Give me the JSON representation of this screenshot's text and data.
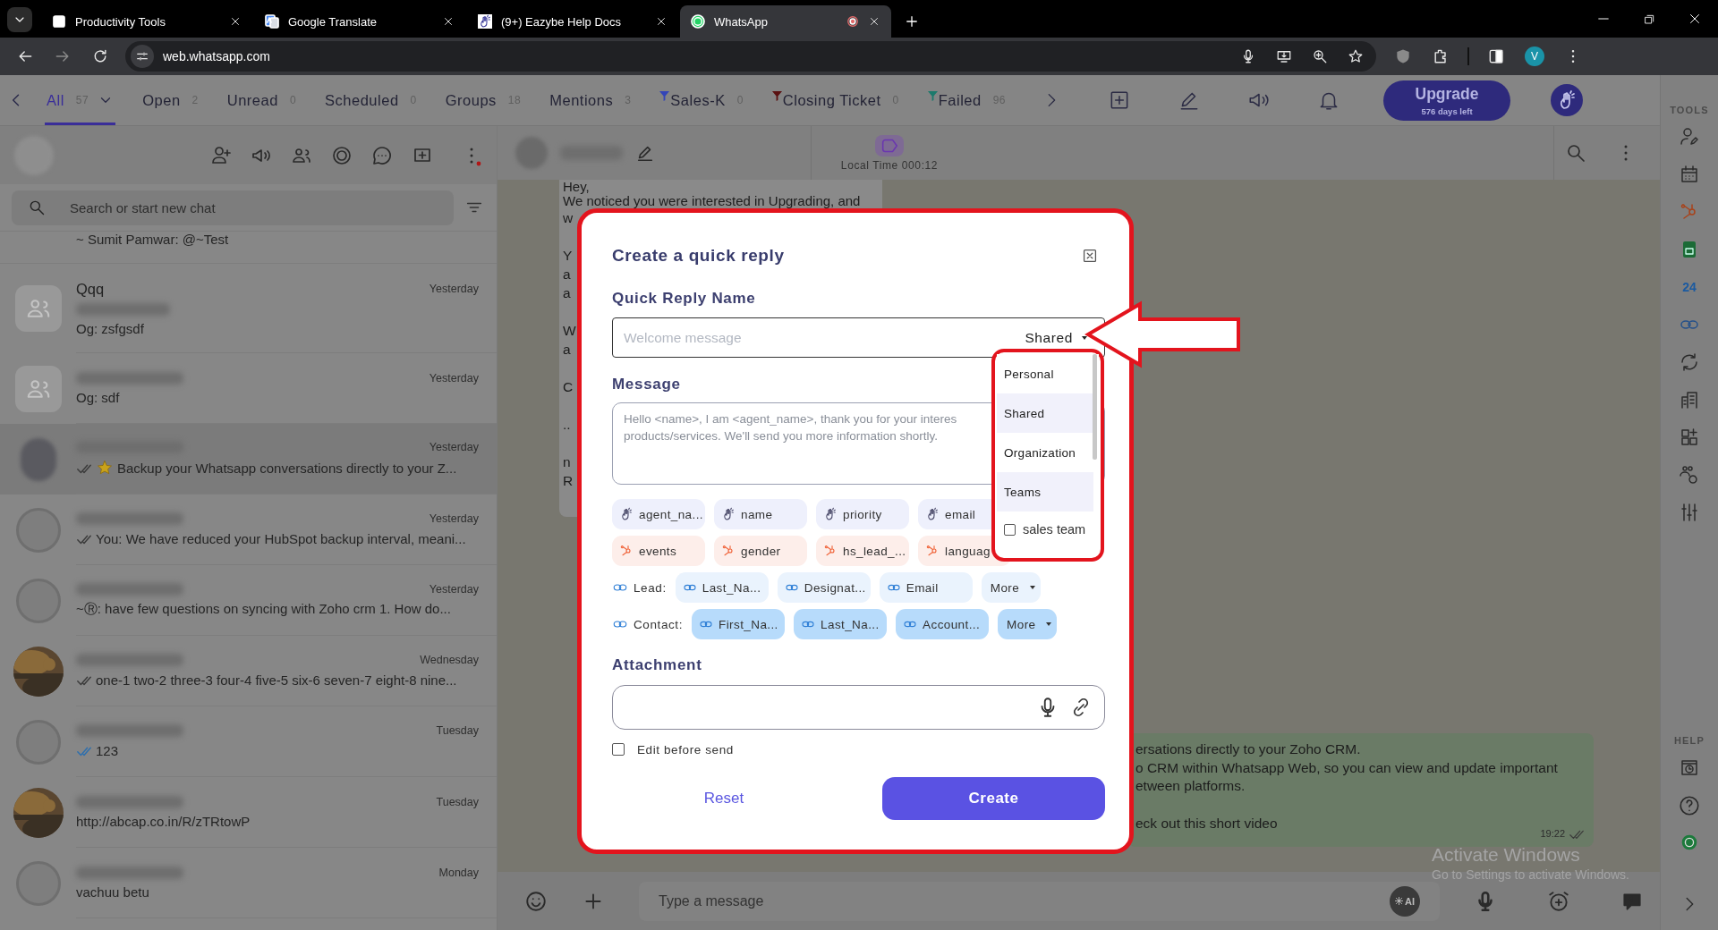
{
  "browser": {
    "tabs": [
      {
        "title": "Productivity Tools",
        "selected": false,
        "recording": false
      },
      {
        "title": "Google Translate",
        "selected": false,
        "recording": false
      },
      {
        "title": "(9+) Eazybe Help Docs",
        "selected": false,
        "recording": false
      },
      {
        "title": "WhatsApp",
        "selected": true,
        "recording": true
      }
    ],
    "url": "web.whatsapp.com",
    "profile_initial": "V"
  },
  "filter_tabs": [
    {
      "label": "All",
      "count": "57",
      "selected": true,
      "kind": "dropdown"
    },
    {
      "label": "Open",
      "count": "2",
      "selected": false,
      "kind": "plain"
    },
    {
      "label": "Unread",
      "count": "0",
      "selected": false,
      "kind": "plain"
    },
    {
      "label": "Scheduled",
      "count": "0",
      "selected": false,
      "kind": "plain"
    },
    {
      "label": "Groups",
      "count": "18",
      "selected": false,
      "kind": "plain"
    },
    {
      "label": "Mentions",
      "count": "3",
      "selected": false,
      "kind": "plain"
    },
    {
      "label": "Sales-K",
      "count": "0",
      "selected": false,
      "kind": "filter",
      "color": "#3345b8"
    },
    {
      "label": "Closing Ticket",
      "count": "0",
      "selected": false,
      "kind": "filter",
      "color": "#5a1111"
    },
    {
      "label": "Failed",
      "count": "96",
      "selected": false,
      "kind": "filter",
      "color": "#1d7a6c"
    }
  ],
  "upgrade": {
    "label": "Upgrade",
    "sublabel": "576 days left"
  },
  "chat_list": {
    "search_placeholder": "Search or start new chat",
    "items": [
      {
        "kind": "partial",
        "preview": "~ Sumit Pamwar: @~Test",
        "selected": false
      },
      {
        "kind": "chat",
        "name": "Qqq",
        "blurred": false,
        "blurred_line": true,
        "avatar": {
          "kind": "group"
        },
        "time": "Yesterday",
        "preview": "Og: zsfgsdf",
        "selected": false
      },
      {
        "kind": "chat",
        "blurred": true,
        "avatar": {
          "kind": "group"
        },
        "time": "Yesterday",
        "preview": "Og: sdf",
        "selected": false
      },
      {
        "kind": "chat",
        "blurred": true,
        "avatar": {
          "kind": "person"
        },
        "time": "Yesterday",
        "ticks": true,
        "read": false,
        "star": true,
        "preview": "Backup your Whatsapp conversations directly to your Z...",
        "selected": true
      },
      {
        "kind": "chat",
        "blurred": true,
        "avatar": {
          "kind": "blank"
        },
        "time": "Yesterday",
        "ticks": true,
        "read": false,
        "preview": "You: We have reduced your HubSpot backup interval, meani...",
        "selected": false
      },
      {
        "kind": "chat",
        "blurred": true,
        "avatar": {
          "kind": "blank"
        },
        "time": "Yesterday",
        "preview": "~Ⓡ: have few questions on syncing with Zoho crm 1. How do...",
        "selected": false
      },
      {
        "kind": "chat",
        "blurred": true,
        "time": "Wednesday",
        "ticks": true,
        "read": false,
        "preview": "one-1 two-2 three-3 four-4 five-5 six-6 seven-7 eight-8 nine...",
        "selected": false
      },
      {
        "kind": "chat",
        "blurred": true,
        "avatar": {
          "kind": "blank"
        },
        "time": "Tuesday",
        "ticks": true,
        "read": true,
        "preview": "123",
        "selected": false
      },
      {
        "kind": "chat",
        "blurred": true,
        "time": "Tuesday",
        "preview": "http://abcap.co.in/R/zTRtowP",
        "selected": false
      },
      {
        "kind": "chat",
        "blurred": true,
        "avatar": {
          "kind": "blank"
        },
        "time": "Monday",
        "preview": "vachuu betu",
        "selected": false
      }
    ]
  },
  "chat": {
    "local_time": "Local Time 000:12",
    "incoming_lines": [
      {
        "kind": "text",
        "text": "Hey,"
      },
      {
        "kind": "text",
        "text": "We noticed you were interested in Upgrading, and"
      },
      {
        "kind": "text",
        "text": "w"
      },
      {
        "kind": "gap"
      },
      {
        "kind": "text",
        "text": "Y"
      },
      {
        "kind": "text",
        "text": "a"
      },
      {
        "kind": "text",
        "text": "a"
      },
      {
        "kind": "gap"
      },
      {
        "kind": "text",
        "text": "W"
      },
      {
        "kind": "text",
        "text": "a"
      },
      {
        "kind": "gap"
      },
      {
        "kind": "text",
        "text": "C"
      },
      {
        "kind": "gap"
      },
      {
        "kind": "text",
        "text": ".."
      },
      {
        "kind": "gap"
      },
      {
        "kind": "text",
        "text": "n"
      },
      {
        "kind": "text",
        "text": "R"
      }
    ],
    "outgoing": {
      "lines": [
        {
          "kind": "text",
          "text": "ersations directly to your Zoho CRM."
        },
        {
          "kind": "text",
          "text": "o CRM within Whatsapp Web, so you can view and update important"
        },
        {
          "kind": "text",
          "text": "etween platforms."
        },
        {
          "kind": "gap"
        },
        {
          "kind": "text",
          "text": "eck out this short video"
        }
      ],
      "time": "19:22"
    },
    "composer_placeholder": "Type a message",
    "ai_label": "AI"
  },
  "windows_notice": {
    "title": "Activate Windows",
    "subtitle": "Go to Settings to activate Windows."
  },
  "tools": {
    "title": "TOOLS",
    "bitrix_label": "24",
    "help_title": "HELP"
  },
  "modal": {
    "title": "Create a quick reply",
    "name_label": "Quick Reply Name",
    "name_placeholder": "Welcome message",
    "visibility": "Shared",
    "visibility_options": [
      {
        "label": "Personal",
        "kind": "option"
      },
      {
        "label": "Shared",
        "kind": "option"
      },
      {
        "label": "Organization",
        "kind": "option"
      },
      {
        "label": "Teams",
        "kind": "option"
      },
      {
        "label": "sales team",
        "kind": "team",
        "checked": false
      }
    ],
    "message_label": "Message",
    "message_placeholder_lines": [
      "Hello <name>, I am <agent_name>, thank you for your interes",
      "products/services. We'll send you more information shortly."
    ],
    "variable_groups": [
      {
        "kind": "eazybe",
        "chips": [
          {
            "label": "agent_na...",
            "kind": "var"
          },
          {
            "label": "name",
            "kind": "var"
          },
          {
            "label": "priority",
            "kind": "var"
          },
          {
            "label": "email",
            "kind": "var"
          }
        ]
      },
      {
        "kind": "hubspot",
        "chips": [
          {
            "label": "events",
            "kind": "var"
          },
          {
            "label": "gender",
            "kind": "var"
          },
          {
            "label": "hs_lead_...",
            "kind": "var"
          },
          {
            "label": "languag",
            "kind": "var"
          }
        ]
      },
      {
        "kind": "lead",
        "label": "Lead:",
        "chips": [
          {
            "label": "Last_Na...",
            "kind": "var"
          },
          {
            "label": "Designat...",
            "kind": "var"
          },
          {
            "label": "Email",
            "kind": "var"
          },
          {
            "label": "More",
            "kind": "more"
          }
        ]
      },
      {
        "kind": "contact",
        "label": "Contact:",
        "chips": [
          {
            "label": "First_Na...",
            "kind": "var"
          },
          {
            "label": "Last_Na...",
            "kind": "var"
          },
          {
            "label": "Account...",
            "kind": "var"
          },
          {
            "label": "More",
            "kind": "more"
          }
        ]
      }
    ],
    "attachment_label": "Attachment",
    "edit_before_send": {
      "label": "Edit before send",
      "checked": false
    },
    "reset_label": "Reset",
    "create_label": "Create"
  }
}
